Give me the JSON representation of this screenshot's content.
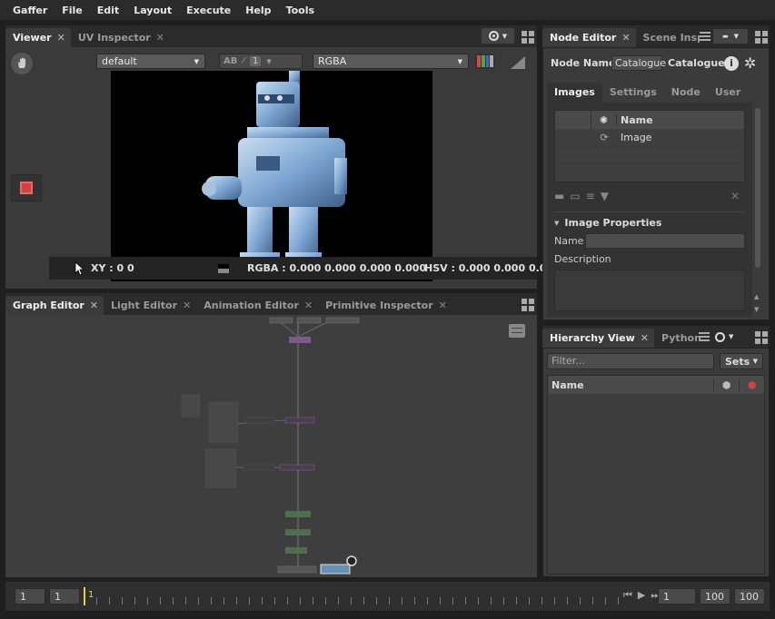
{
  "menubar": [
    "Gaffer",
    "File",
    "Edit",
    "Layout",
    "Execute",
    "Help",
    "Tools"
  ],
  "viewer": {
    "tabs": [
      "Viewer",
      "UV Inspector"
    ],
    "display_dropdown": "default",
    "channels_dropdown": "RGBA",
    "ab_label": "AB",
    "compare_count": "1",
    "status": {
      "xy": "XY : 0 0",
      "rgba": "RGBA : 0.000 0.000 0.000 0.000",
      "hsv": "HSV : 0.000 0.000 0.0"
    }
  },
  "graph_editor": {
    "tabs": [
      "Graph Editor",
      "Light Editor",
      "Animation Editor",
      "Primitive Inspector"
    ]
  },
  "node_editor": {
    "tabs": [
      "Node Editor",
      "Scene Insp"
    ],
    "node_name_label": "Node Name",
    "node_name_value": "Catalogue",
    "node_type": "Catalogue",
    "section_tabs": [
      "Images",
      "Settings",
      "Node",
      "User"
    ],
    "table_header": "Name",
    "rows": [
      "Image",
      "",
      ""
    ],
    "properties_title": "Image Properties",
    "name_label": "Name",
    "description_label": "Description"
  },
  "hierarchy": {
    "tabs": [
      "Hierarchy View",
      "Python"
    ],
    "filter_placeholder": "Filter...",
    "sets_label": "Sets",
    "column_name": "Name"
  },
  "timeline": {
    "start": "1",
    "current_start": "1",
    "current_frame": "1",
    "frame_field": "1",
    "end_current": "100",
    "end": "100"
  },
  "colors": {
    "accent_yellow": "#e6d24a",
    "node_purple": "#7a5a8a",
    "node_green": "#4f6e4f",
    "selected_blue": "#6a8fb5"
  }
}
